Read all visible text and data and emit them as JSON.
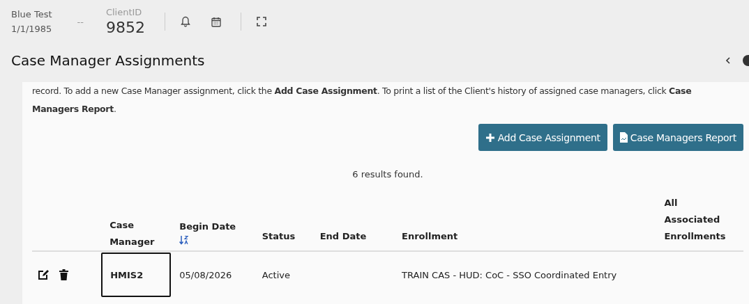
{
  "client": {
    "name": "Blue Test",
    "dob": "1/1/1985",
    "separator": "--",
    "id_label": "ClientID",
    "id": "9852"
  },
  "page_title": "Case Manager Assignments",
  "intro": "record. To add a new Case Manager assignment, click the **Add Case Assignment**.  To print a list of the Client's history of assigned case managers, click **Case Managers Report**.",
  "buttons": [
    {
      "kind": "add",
      "label": "Add Case Assignment"
    },
    {
      "kind": "report",
      "label": "Case Managers Report"
    }
  ],
  "results": "6 results found.",
  "table": {
    "columns": [
      {
        "label": "Case Manager",
        "sorted": false
      },
      {
        "label": "Begin Date",
        "sorted": true
      },
      {
        "label": "Status",
        "sorted": false
      },
      {
        "label": "End Date",
        "sorted": false
      },
      {
        "label": "Enrollment",
        "sorted": false
      },
      {
        "label": "All Associated Enrollments",
        "sorted": false
      }
    ],
    "rows": [
      {
        "case_manager": "HMIS2",
        "focused": true,
        "begin_date": "05/08/2026",
        "status": "Active",
        "end_date": "",
        "enrollment": "TRAIN CAS - HUD: CoC - SSO Coordinated Entry"
      }
    ]
  }
}
